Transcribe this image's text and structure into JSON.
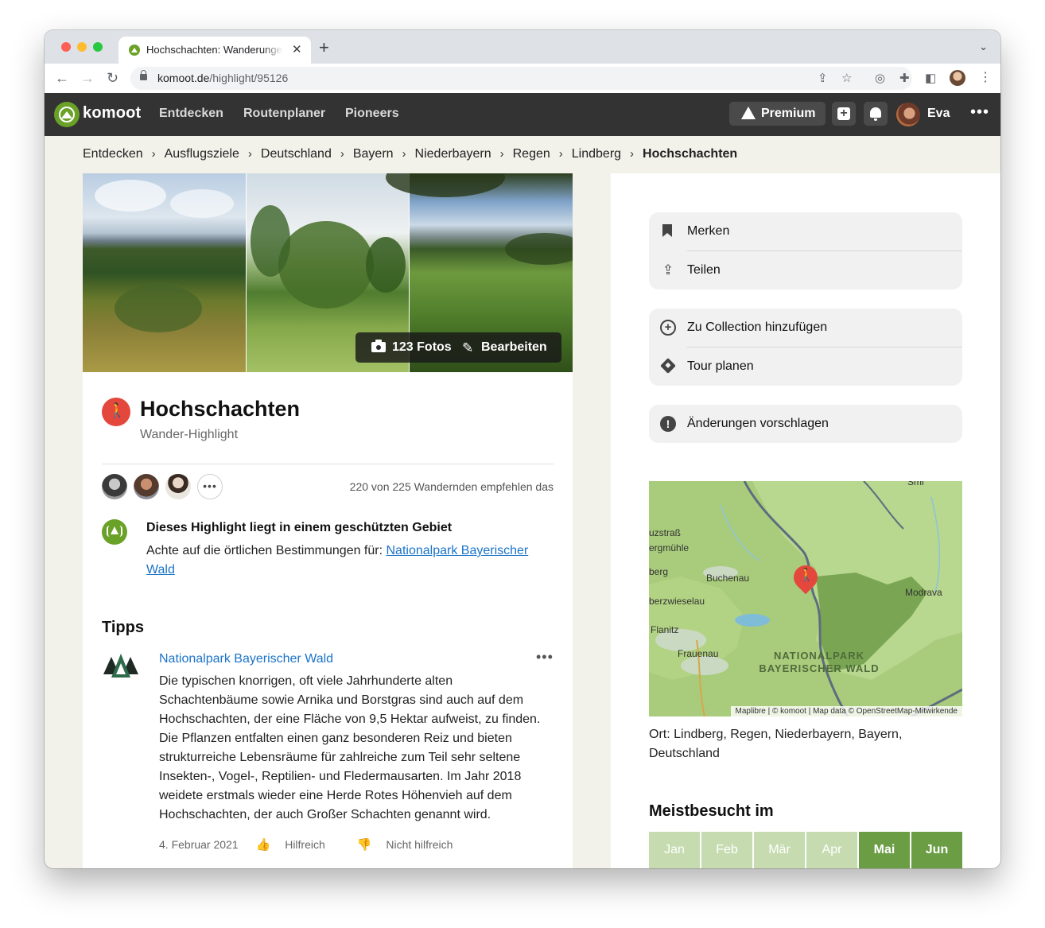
{
  "browser": {
    "tab_title": "Hochschachten: Wanderungen und mehr",
    "url_host": "komoot.de",
    "url_path": "/highlight/95126",
    "icons": [
      "back-icon",
      "forward-icon",
      "reload-icon",
      "lock-icon",
      "share-icon",
      "star-icon",
      "extensions-icon",
      "sidebar-icon",
      "chrome-menu-icon"
    ]
  },
  "header": {
    "logo": "komoot",
    "nav": [
      "Entdecken",
      "Routenplaner",
      "Pioneers"
    ],
    "premium_label": "Premium",
    "user_name": "Eva",
    "brand_color": "#6aa127"
  },
  "breadcrumb": [
    "Entdecken",
    "Ausflugsziele",
    "Deutschland",
    "Bayern",
    "Niederbayern",
    "Regen",
    "Lindberg",
    "Hochschachten"
  ],
  "gallery": {
    "photos_label": "123 Fotos",
    "edit_label": "Bearbeiten"
  },
  "highlight": {
    "title": "Hochschachten",
    "subtitle": "Wander-Highlight",
    "recommend_text": "220 von 225 Wandernden empfehlen das",
    "accent_color": "#e4473c"
  },
  "protected": {
    "title": "Dieses Highlight liegt in einem geschützten Gebiet",
    "text": "Achte auf die örtlichen Bestimmungen für: ",
    "link": "Nationalpark Bayerischer Wald"
  },
  "tips": {
    "heading": "Tipps",
    "author": "Nationalpark Bayerischer Wald",
    "body": "Die typischen knorrigen, oft viele Jahrhunderte alten Schachtenbäume sowie Arnika und Borstgras sind auch auf dem Hochschachten, der eine Fläche von 9,5 Hektar aufweist, zu finden. Die Pflanzen entfalten einen ganz besonderen Reiz und bieten strukturreiche Lebensräume für zahlreiche zum Teil sehr seltene Insekten-, Vogel-, Reptilien- und Fledermausarten. Im Jahr 2018 weidete erstmals wieder eine Herde Rotes Höhenvieh auf dem Hochschachten, der auch Großer Schachten genannt wird.",
    "date": "4. Februar 2021",
    "helpful": "Hilfreich",
    "not_helpful": "Nicht hilfreich"
  },
  "actions": {
    "save": "Merken",
    "share": "Teilen",
    "add_collection": "Zu Collection hinzufügen",
    "plan_tour": "Tour planen",
    "suggest_changes": "Änderungen vorschlagen"
  },
  "map": {
    "labels": [
      "Smi",
      "uzstraß",
      "ergmühle",
      "berg",
      "Buchenau",
      "berzwieselau",
      "Flanitz",
      "Frauenau",
      "Modrava"
    ],
    "park_label_1": "NATIONALPARK",
    "park_label_2": "BAYERISCHER WALD",
    "attribution": "Maplibre | © komoot | Map data © OpenStreetMap-Mitwirkende"
  },
  "location": "Ort: Lindberg, Regen, Niederbayern, Bayern, Deutschland",
  "visits": {
    "heading": "Meistbesucht im",
    "months": [
      "Jan",
      "Feb",
      "Mär",
      "Apr",
      "Mai",
      "Jun"
    ],
    "highlighted": [
      "Mai",
      "Jun"
    ]
  }
}
